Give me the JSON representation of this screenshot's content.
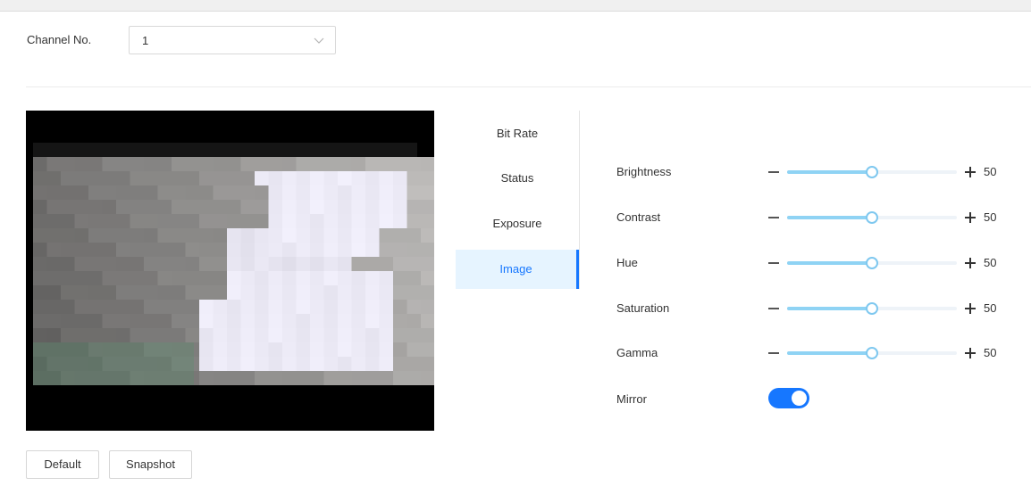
{
  "channel": {
    "label": "Channel No.",
    "value": "1"
  },
  "tabs": [
    {
      "label": "Bit Rate",
      "active": false
    },
    {
      "label": "Status",
      "active": false
    },
    {
      "label": "Exposure",
      "active": false
    },
    {
      "label": "Image",
      "active": true
    }
  ],
  "settings": [
    {
      "label": "Brightness",
      "value": "50",
      "level": 0.5
    },
    {
      "label": "Contrast",
      "value": "50",
      "level": 0.5
    },
    {
      "label": "Hue",
      "value": "50",
      "level": 0.5
    },
    {
      "label": "Saturation",
      "value": "50",
      "level": 0.5
    },
    {
      "label": "Gamma",
      "value": "50",
      "level": 0.5
    }
  ],
  "mirror": {
    "label": "Mirror",
    "enabled": true
  },
  "buttons": {
    "default_label": "Default",
    "snapshot_label": "Snapshot"
  },
  "colors": {
    "accent": "#1677ff",
    "slider_fill": "#8fd3f4",
    "active_tab_bg": "#e6f4ff"
  },
  "icons": {
    "dropdown": "chevron-down-icon",
    "decrease": "minus-icon",
    "increase": "plus-icon"
  }
}
